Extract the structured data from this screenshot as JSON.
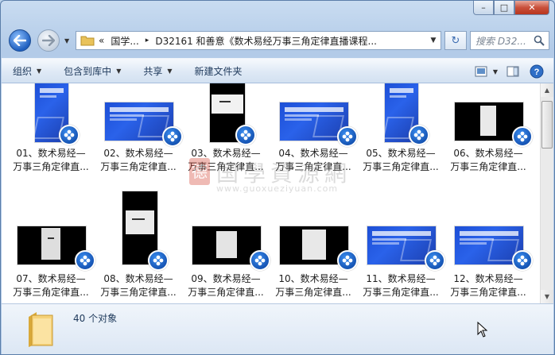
{
  "window": {
    "caption_buttons": {
      "minimize": "–",
      "maximize": "□",
      "close": "✕"
    }
  },
  "nav": {
    "breadcrumb": [
      "«",
      "国学...",
      "▸",
      "D32161 和善意《数术易经万事三角定律直播课程..."
    ],
    "search_placeholder": "搜索 D32...",
    "dropdown_glyph": "▼",
    "refresh_glyph": "↻"
  },
  "toolbar": {
    "organize": "组织",
    "include_library": "包含到库中",
    "share": "共享",
    "new_folder": "新建文件夹",
    "help": "?"
  },
  "files": [
    {
      "line1": "01、数术易经—",
      "line2": "万事三角定律直..."
    },
    {
      "line1": "02、数术易经—",
      "line2": "万事三角定律直..."
    },
    {
      "line1": "03、数术易经—",
      "line2": "万事三角定律直..."
    },
    {
      "line1": "04、数术易经—",
      "line2": "万事三角定律直..."
    },
    {
      "line1": "05、数术易经—",
      "line2": "万事三角定律直..."
    },
    {
      "line1": "06、数术易经—",
      "line2": "万事三角定律直..."
    },
    {
      "line1": "07、数术易经—",
      "line2": "万事三角定律直..."
    },
    {
      "line1": "08、数术易经—",
      "line2": "万事三角定律直..."
    },
    {
      "line1": "09、数术易经—",
      "line2": "万事三角定律直..."
    },
    {
      "line1": "10、数术易经—",
      "line2": "万事三角定律直..."
    },
    {
      "line1": "11、数术易经—",
      "line2": "万事三角定律直..."
    },
    {
      "line1": "12、数术易经—",
      "line2": "万事三角定律直..."
    }
  ],
  "watermark": {
    "seal": "德",
    "text": "国學資源網",
    "url": "www.guoxueziyuan.com"
  },
  "status": {
    "count": "40 个对象"
  },
  "icons": [
    "back-arrow-icon",
    "forward-arrow-icon",
    "folder-icon",
    "refresh-icon",
    "search-icon",
    "view-icon",
    "preview-pane-icon",
    "help-icon",
    "video-badge-icon",
    "cursor-icon"
  ]
}
